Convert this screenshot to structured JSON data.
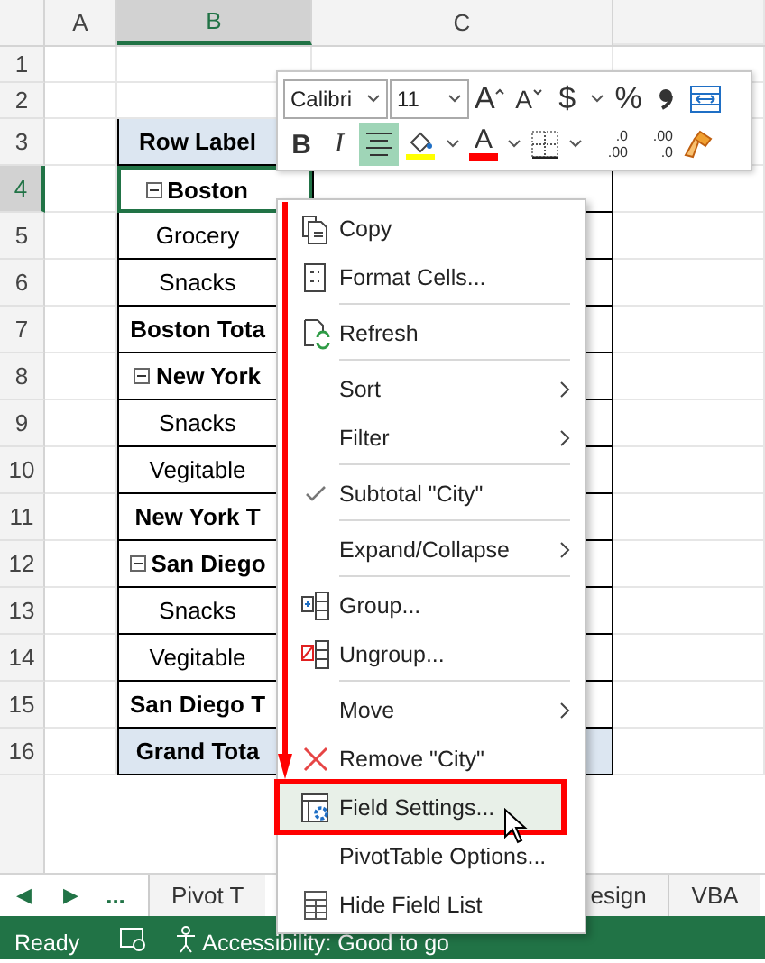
{
  "columns": [
    {
      "label": "A",
      "selected": false
    },
    {
      "label": "B",
      "selected": true
    },
    {
      "label": "C",
      "selected": false
    }
  ],
  "rows": [
    {
      "number": "1",
      "selected": false
    },
    {
      "number": "2",
      "selected": false
    },
    {
      "number": "3",
      "selected": false,
      "kind": "header",
      "label": "Row Label"
    },
    {
      "number": "4",
      "selected": true,
      "kind": "group",
      "label": "Boston"
    },
    {
      "number": "5",
      "selected": false,
      "kind": "item",
      "label": "Grocery"
    },
    {
      "number": "6",
      "selected": false,
      "kind": "item",
      "label": "Snacks"
    },
    {
      "number": "7",
      "selected": false,
      "kind": "subtotal",
      "label": "Boston Tota"
    },
    {
      "number": "8",
      "selected": false,
      "kind": "group",
      "label": "New York"
    },
    {
      "number": "9",
      "selected": false,
      "kind": "item",
      "label": "Snacks"
    },
    {
      "number": "10",
      "selected": false,
      "kind": "item",
      "label": "Vegitable"
    },
    {
      "number": "11",
      "selected": false,
      "kind": "subtotal",
      "label": "New York T"
    },
    {
      "number": "12",
      "selected": false,
      "kind": "group",
      "label": "San Diego"
    },
    {
      "number": "13",
      "selected": false,
      "kind": "item",
      "label": "Snacks"
    },
    {
      "number": "14",
      "selected": false,
      "kind": "item",
      "label": "Vegitable"
    },
    {
      "number": "15",
      "selected": false,
      "kind": "subtotal",
      "label": "San Diego T"
    },
    {
      "number": "16",
      "selected": false,
      "kind": "grand",
      "label": "Grand Tota"
    }
  ],
  "mini_toolbar": {
    "font_tools": [
      {
        "kind": "font-box",
        "value": "Calibri"
      },
      {
        "kind": "size-box",
        "value": "11"
      },
      {
        "kind": "grow",
        "label": "A"
      },
      {
        "kind": "shrink",
        "label": "A"
      },
      {
        "kind": "glyph",
        "label": "$"
      },
      {
        "kind": "caret"
      },
      {
        "kind": "glyph",
        "label": "%"
      },
      {
        "kind": "comma"
      },
      {
        "kind": "wrap"
      }
    ],
    "format_tools": [
      {
        "kind": "bold",
        "label": "B",
        "on": false
      },
      {
        "kind": "italic",
        "label": "I",
        "on": false
      },
      {
        "kind": "align",
        "on": true
      },
      {
        "kind": "fill"
      },
      {
        "kind": "caret"
      },
      {
        "kind": "font-color",
        "label": "A"
      },
      {
        "kind": "caret"
      },
      {
        "kind": "borders"
      },
      {
        "kind": "caret"
      },
      {
        "kind": "inc-decimal",
        "lines": [
          ".0",
          ".00"
        ]
      },
      {
        "kind": "dec-decimal",
        "lines": [
          ".00",
          ".0"
        ]
      },
      {
        "kind": "painter"
      }
    ]
  },
  "context_menu": {
    "items": [
      {
        "label": "Copy",
        "kind": "copy",
        "submenu": false,
        "checked": false,
        "selected": false,
        "framed": false,
        "separator_before": false
      },
      {
        "label": "Format Cells...",
        "kind": "format",
        "submenu": false,
        "checked": false,
        "selected": false,
        "framed": false,
        "separator_before": false
      },
      {
        "label": "Refresh",
        "kind": "refresh",
        "submenu": false,
        "checked": false,
        "selected": false,
        "framed": false,
        "separator_before": true
      },
      {
        "label": "Sort",
        "kind": "plain",
        "submenu": true,
        "checked": false,
        "selected": false,
        "framed": false,
        "separator_before": true
      },
      {
        "label": "Filter",
        "kind": "plain",
        "submenu": true,
        "checked": false,
        "selected": false,
        "framed": false,
        "separator_before": false
      },
      {
        "label": "Subtotal \"City\"",
        "kind": "plain",
        "submenu": false,
        "checked": true,
        "selected": false,
        "framed": false,
        "separator_before": true
      },
      {
        "label": "Expand/Collapse",
        "kind": "plain",
        "submenu": true,
        "checked": false,
        "selected": false,
        "framed": false,
        "separator_before": true
      },
      {
        "label": "Group...",
        "kind": "group",
        "submenu": false,
        "checked": false,
        "selected": false,
        "framed": false,
        "separator_before": true
      },
      {
        "label": "Ungroup...",
        "kind": "ungroup",
        "submenu": false,
        "checked": false,
        "selected": false,
        "framed": false,
        "separator_before": false
      },
      {
        "label": "Move",
        "kind": "plain",
        "submenu": true,
        "checked": false,
        "selected": false,
        "framed": false,
        "separator_before": true
      },
      {
        "label": "Remove \"City\"",
        "kind": "remove",
        "submenu": false,
        "checked": false,
        "selected": false,
        "framed": false,
        "separator_before": false
      },
      {
        "label": "Field Settings...",
        "kind": "field",
        "submenu": false,
        "checked": false,
        "selected": true,
        "framed": true,
        "separator_before": false
      },
      {
        "label": "PivotTable Options...",
        "kind": "plain",
        "submenu": false,
        "checked": false,
        "selected": false,
        "framed": false,
        "separator_before": false
      },
      {
        "label": "Hide Field List",
        "kind": "hide",
        "submenu": false,
        "checked": false,
        "selected": false,
        "framed": false,
        "separator_before": false
      }
    ]
  },
  "sheet_tabs": {
    "nav": [
      "◀",
      "▶",
      "..."
    ],
    "tabs": [
      {
        "label": "Pivot T",
        "selected": false
      },
      {
        "label": "esign",
        "selected": false
      },
      {
        "label": "VBA",
        "selected": false
      }
    ]
  },
  "status_bar": {
    "mode": "Ready",
    "accessibility": "Accessibility: Good to go"
  }
}
